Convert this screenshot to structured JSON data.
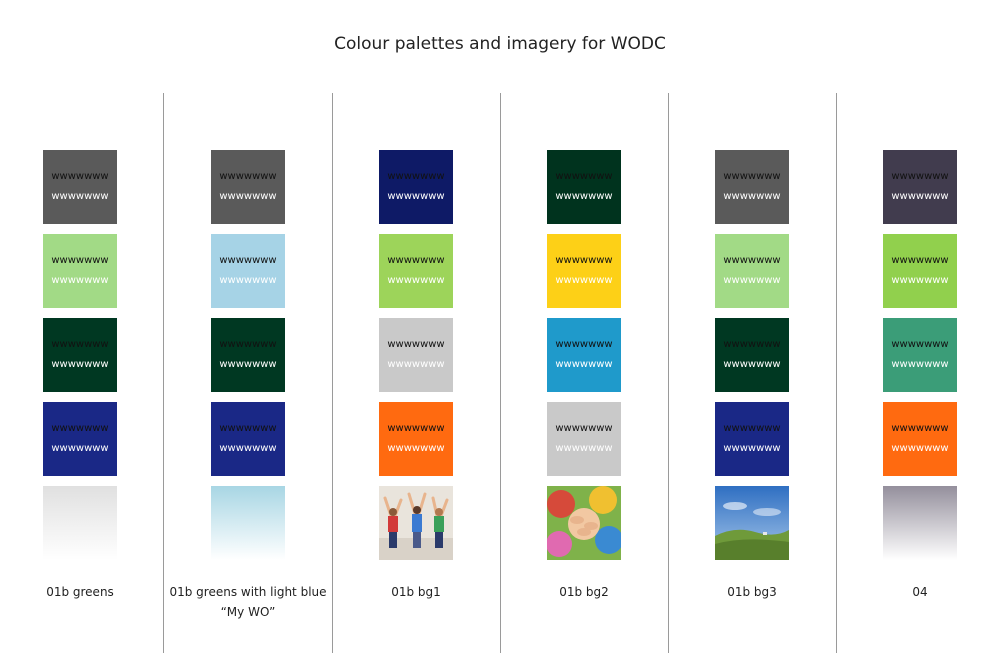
{
  "page": {
    "title": "Colour palettes and imagery for WODC"
  },
  "sample_text": "wwwwwww",
  "columns": [
    {
      "label": "01b greens",
      "swatches": [
        "#5a5a5a",
        "#a2da86",
        "#003822",
        "#1a2886"
      ],
      "bottom": {
        "kind": "gradient",
        "color": "#e0e0e0"
      }
    },
    {
      "label": "01b greens with light blue “My WO”",
      "swatches": [
        "#5a5a5a",
        "#a6d3e6",
        "#003822",
        "#1a2886"
      ],
      "bottom": {
        "kind": "gradient",
        "color": "#a8d6e4"
      }
    },
    {
      "label": "01b bg1",
      "swatches": [
        "#0e1a66",
        "#9dd45a",
        "#c9c9c9",
        "#ff6a10"
      ],
      "bottom": {
        "kind": "photo",
        "photo": "jumping-people-photo"
      }
    },
    {
      "label": "01b bg2",
      "swatches": [
        "#00331e",
        "#fdd017",
        "#1f9acb",
        "#c9c9c9"
      ],
      "bottom": {
        "kind": "photo",
        "photo": "group-hands-photo"
      }
    },
    {
      "label": "01b bg3",
      "swatches": [
        "#5a5a5a",
        "#a2da86",
        "#003822",
        "#1a2886"
      ],
      "bottom": {
        "kind": "photo",
        "photo": "countryside-landscape-photo"
      }
    },
    {
      "label": "04",
      "swatches": [
        "#413c4e",
        "#91d04d",
        "#3b9d78",
        "#ff6a10"
      ],
      "bottom": {
        "kind": "gradient",
        "color": "#948f9c"
      }
    }
  ]
}
